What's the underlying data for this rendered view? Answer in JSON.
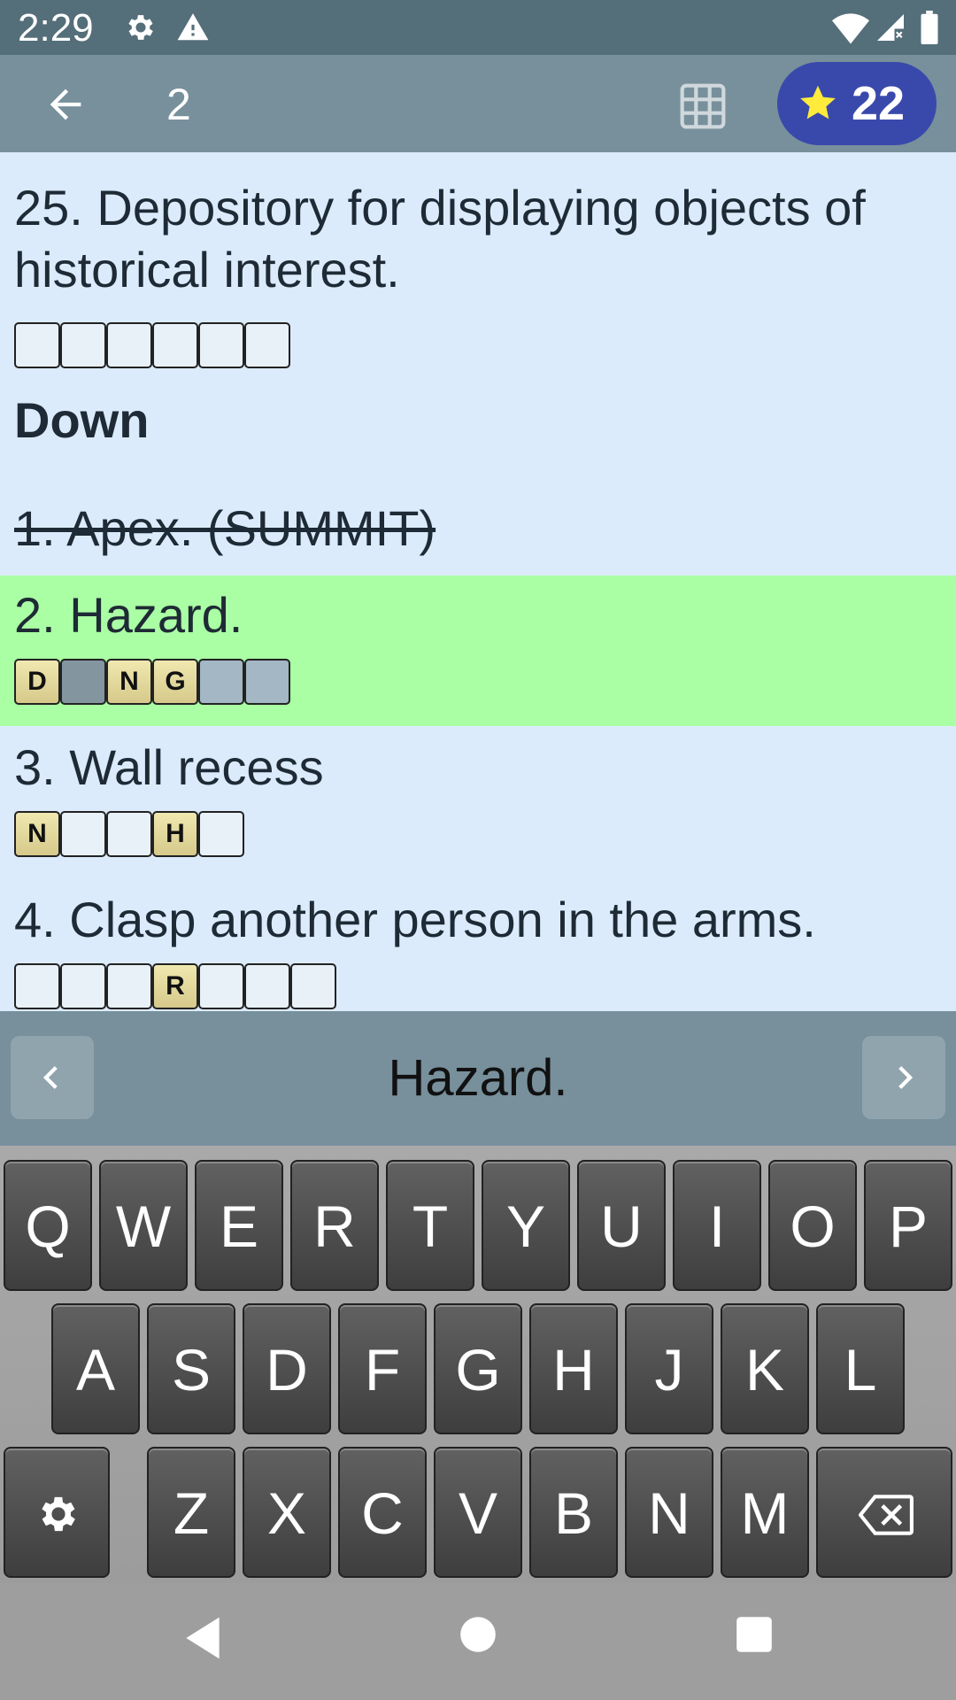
{
  "status_bar": {
    "time": "2:29"
  },
  "toolbar": {
    "title": "2",
    "score": "22"
  },
  "clues": {
    "across_25": {
      "text": "25. Depository for displaying objects of historical interest.",
      "cells": [
        "",
        "",
        "",
        "",
        "",
        ""
      ]
    },
    "down_heading": "Down",
    "down_1": {
      "text": "1. Apex. (SUMMIT)"
    },
    "down_2": {
      "text": "2. Hazard.",
      "cells": [
        "D",
        "",
        "N",
        "G",
        "",
        ""
      ]
    },
    "down_3": {
      "text": "3. Wall recess",
      "cells": [
        "N",
        "",
        "",
        "H",
        ""
      ]
    },
    "down_4": {
      "text": "4. Clasp another person in the arms.",
      "cells": [
        "",
        "",
        "",
        "R",
        "",
        "",
        ""
      ]
    }
  },
  "clue_bar": {
    "text": "Hazard."
  },
  "keyboard": {
    "row1": [
      "Q",
      "W",
      "E",
      "R",
      "T",
      "Y",
      "U",
      "I",
      "O",
      "P"
    ],
    "row2": [
      "A",
      "S",
      "D",
      "F",
      "G",
      "H",
      "J",
      "K",
      "L"
    ],
    "row3": [
      "Z",
      "X",
      "C",
      "V",
      "B",
      "N",
      "M"
    ]
  },
  "colors": {
    "status_bar": "#546e7a",
    "toolbar": "#78909c",
    "score_pill": "#3949ab",
    "star": "#ffeb3b",
    "list_bg": "#dcebfb",
    "highlight": "#aaffa4",
    "letter_cell": "#e4d89c"
  }
}
